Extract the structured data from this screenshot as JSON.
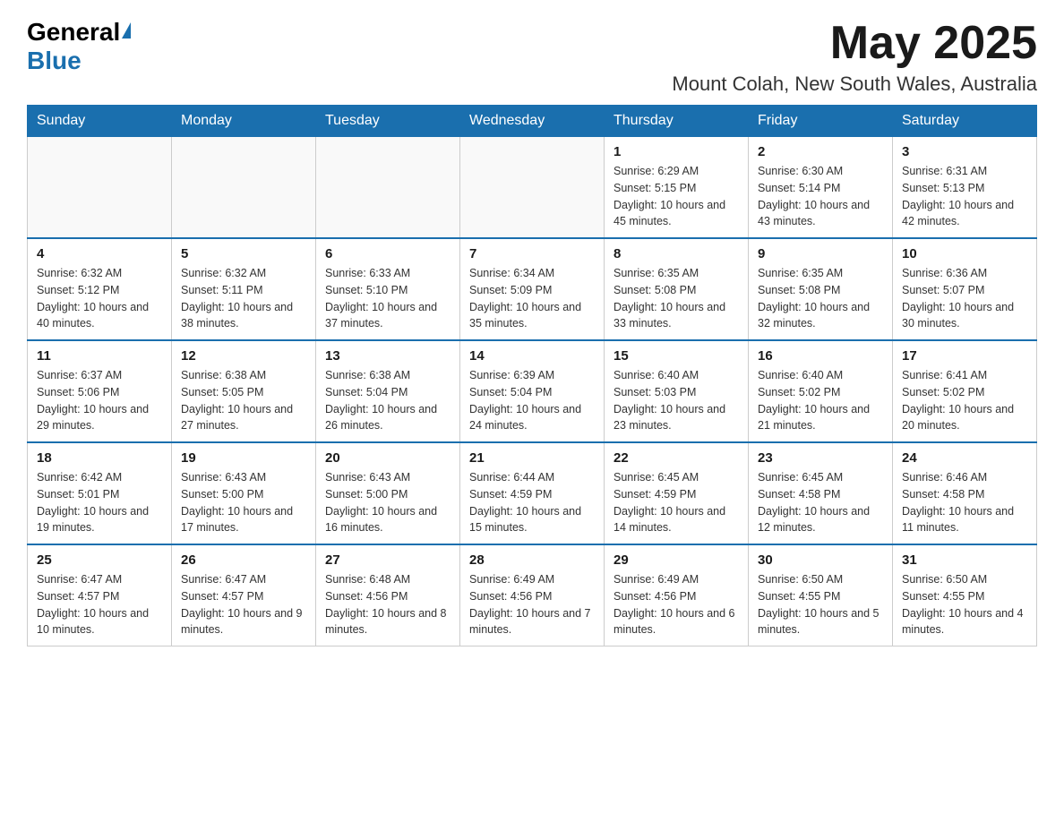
{
  "logo": {
    "general": "General",
    "blue": "Blue"
  },
  "header": {
    "month_title": "May 2025",
    "location": "Mount Colah, New South Wales, Australia"
  },
  "days_of_week": [
    "Sunday",
    "Monday",
    "Tuesday",
    "Wednesday",
    "Thursday",
    "Friday",
    "Saturday"
  ],
  "weeks": [
    [
      {
        "day": "",
        "info": ""
      },
      {
        "day": "",
        "info": ""
      },
      {
        "day": "",
        "info": ""
      },
      {
        "day": "",
        "info": ""
      },
      {
        "day": "1",
        "info": "Sunrise: 6:29 AM\nSunset: 5:15 PM\nDaylight: 10 hours and 45 minutes."
      },
      {
        "day": "2",
        "info": "Sunrise: 6:30 AM\nSunset: 5:14 PM\nDaylight: 10 hours and 43 minutes."
      },
      {
        "day": "3",
        "info": "Sunrise: 6:31 AM\nSunset: 5:13 PM\nDaylight: 10 hours and 42 minutes."
      }
    ],
    [
      {
        "day": "4",
        "info": "Sunrise: 6:32 AM\nSunset: 5:12 PM\nDaylight: 10 hours and 40 minutes."
      },
      {
        "day": "5",
        "info": "Sunrise: 6:32 AM\nSunset: 5:11 PM\nDaylight: 10 hours and 38 minutes."
      },
      {
        "day": "6",
        "info": "Sunrise: 6:33 AM\nSunset: 5:10 PM\nDaylight: 10 hours and 37 minutes."
      },
      {
        "day": "7",
        "info": "Sunrise: 6:34 AM\nSunset: 5:09 PM\nDaylight: 10 hours and 35 minutes."
      },
      {
        "day": "8",
        "info": "Sunrise: 6:35 AM\nSunset: 5:08 PM\nDaylight: 10 hours and 33 minutes."
      },
      {
        "day": "9",
        "info": "Sunrise: 6:35 AM\nSunset: 5:08 PM\nDaylight: 10 hours and 32 minutes."
      },
      {
        "day": "10",
        "info": "Sunrise: 6:36 AM\nSunset: 5:07 PM\nDaylight: 10 hours and 30 minutes."
      }
    ],
    [
      {
        "day": "11",
        "info": "Sunrise: 6:37 AM\nSunset: 5:06 PM\nDaylight: 10 hours and 29 minutes."
      },
      {
        "day": "12",
        "info": "Sunrise: 6:38 AM\nSunset: 5:05 PM\nDaylight: 10 hours and 27 minutes."
      },
      {
        "day": "13",
        "info": "Sunrise: 6:38 AM\nSunset: 5:04 PM\nDaylight: 10 hours and 26 minutes."
      },
      {
        "day": "14",
        "info": "Sunrise: 6:39 AM\nSunset: 5:04 PM\nDaylight: 10 hours and 24 minutes."
      },
      {
        "day": "15",
        "info": "Sunrise: 6:40 AM\nSunset: 5:03 PM\nDaylight: 10 hours and 23 minutes."
      },
      {
        "day": "16",
        "info": "Sunrise: 6:40 AM\nSunset: 5:02 PM\nDaylight: 10 hours and 21 minutes."
      },
      {
        "day": "17",
        "info": "Sunrise: 6:41 AM\nSunset: 5:02 PM\nDaylight: 10 hours and 20 minutes."
      }
    ],
    [
      {
        "day": "18",
        "info": "Sunrise: 6:42 AM\nSunset: 5:01 PM\nDaylight: 10 hours and 19 minutes."
      },
      {
        "day": "19",
        "info": "Sunrise: 6:43 AM\nSunset: 5:00 PM\nDaylight: 10 hours and 17 minutes."
      },
      {
        "day": "20",
        "info": "Sunrise: 6:43 AM\nSunset: 5:00 PM\nDaylight: 10 hours and 16 minutes."
      },
      {
        "day": "21",
        "info": "Sunrise: 6:44 AM\nSunset: 4:59 PM\nDaylight: 10 hours and 15 minutes."
      },
      {
        "day": "22",
        "info": "Sunrise: 6:45 AM\nSunset: 4:59 PM\nDaylight: 10 hours and 14 minutes."
      },
      {
        "day": "23",
        "info": "Sunrise: 6:45 AM\nSunset: 4:58 PM\nDaylight: 10 hours and 12 minutes."
      },
      {
        "day": "24",
        "info": "Sunrise: 6:46 AM\nSunset: 4:58 PM\nDaylight: 10 hours and 11 minutes."
      }
    ],
    [
      {
        "day": "25",
        "info": "Sunrise: 6:47 AM\nSunset: 4:57 PM\nDaylight: 10 hours and 10 minutes."
      },
      {
        "day": "26",
        "info": "Sunrise: 6:47 AM\nSunset: 4:57 PM\nDaylight: 10 hours and 9 minutes."
      },
      {
        "day": "27",
        "info": "Sunrise: 6:48 AM\nSunset: 4:56 PM\nDaylight: 10 hours and 8 minutes."
      },
      {
        "day": "28",
        "info": "Sunrise: 6:49 AM\nSunset: 4:56 PM\nDaylight: 10 hours and 7 minutes."
      },
      {
        "day": "29",
        "info": "Sunrise: 6:49 AM\nSunset: 4:56 PM\nDaylight: 10 hours and 6 minutes."
      },
      {
        "day": "30",
        "info": "Sunrise: 6:50 AM\nSunset: 4:55 PM\nDaylight: 10 hours and 5 minutes."
      },
      {
        "day": "31",
        "info": "Sunrise: 6:50 AM\nSunset: 4:55 PM\nDaylight: 10 hours and 4 minutes."
      }
    ]
  ]
}
